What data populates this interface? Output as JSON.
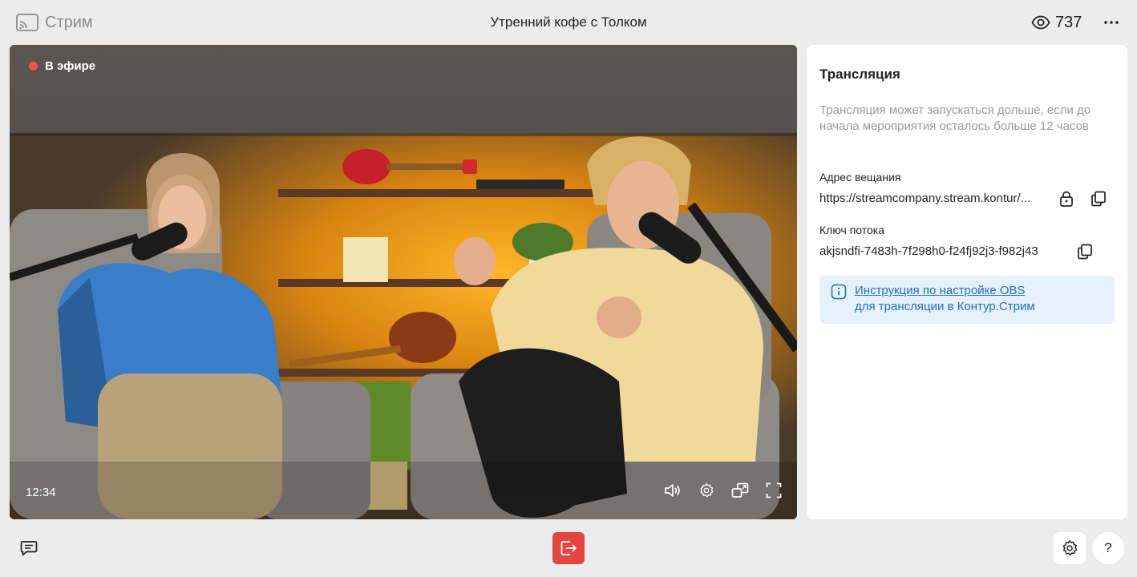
{
  "header": {
    "brand_label": "Стрим",
    "brand_icon": "cast-icon",
    "title": "Утренний кофе с Толком",
    "viewers_count": "737",
    "viewers_icon": "eye-icon",
    "more_icon": "more-horizontal-icon"
  },
  "video": {
    "live_label": "В эфире",
    "live_color": "#ff4d4d",
    "time": "12:34",
    "controls": [
      "volume-icon",
      "settings-icon",
      "picture-in-picture-icon",
      "fullscreen-icon"
    ]
  },
  "panel": {
    "title": "Трансляция",
    "note": "Трансляция может запускаться дольше, если до начала мероприятия осталось больше 12 часов",
    "broadcast_address_label": "Адрес вещания",
    "broadcast_address_value": "https://streamcompany.stream.kontur/...",
    "stream_key_label": "Ключ потока",
    "stream_key_value": "akjsndfi-7483h-7f298h0-f24fj92j3-f982j43",
    "info_link": "Инструкция по настройке OBS",
    "info_text": "для трансляции в Контур.Стрим",
    "info_color": "#1f6fc5"
  },
  "bottom": {
    "chat_icon": "chat-icon",
    "leave_icon": "exit-icon",
    "leave_color": "#e4463f",
    "settings_icon": "gear-icon",
    "help_label": "?"
  }
}
